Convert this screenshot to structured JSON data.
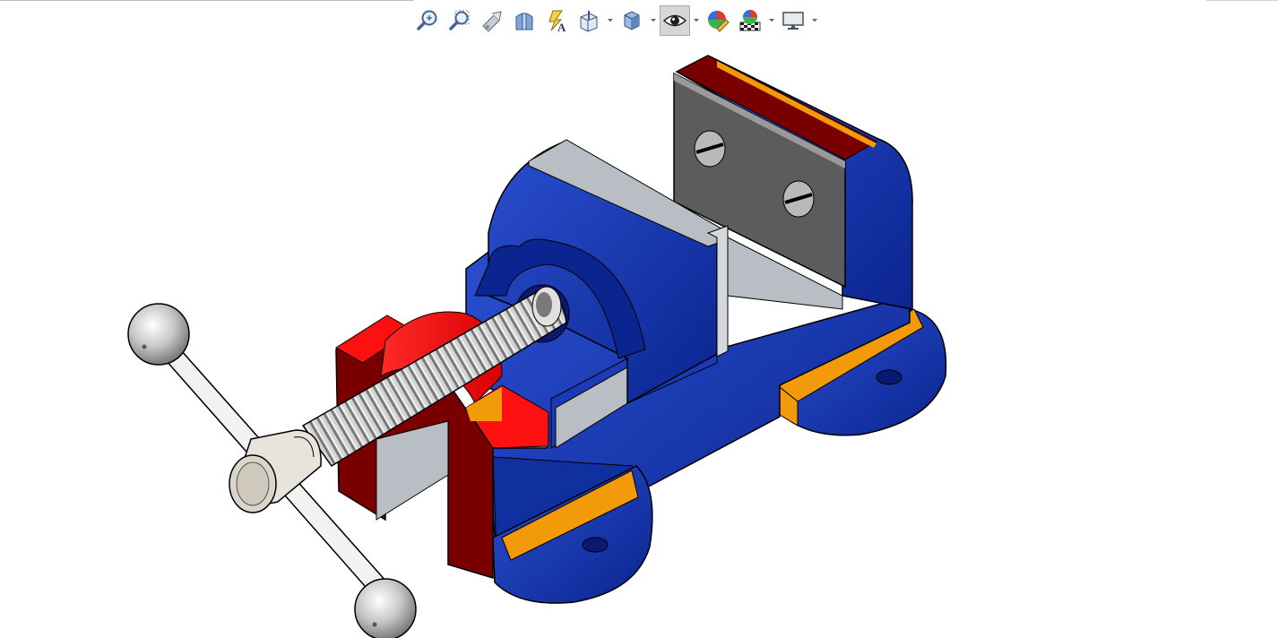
{
  "toolbar": {
    "tools": [
      {
        "name": "zoom-to-fit",
        "icon": "zoom-fit-icon"
      },
      {
        "name": "zoom-to-area",
        "icon": "zoom-area-icon"
      },
      {
        "name": "previous-view",
        "icon": "previous-view-icon"
      },
      {
        "name": "section-view",
        "icon": "section-view-icon"
      },
      {
        "name": "dynamic-annotation-views",
        "icon": "annotation-view-icon"
      },
      {
        "name": "view-orientation",
        "icon": "view-orientation-icon",
        "dropdown": true
      },
      {
        "name": "display-style",
        "icon": "display-style-icon",
        "dropdown": true
      },
      {
        "name": "hide-show-items",
        "icon": "eye-icon",
        "dropdown": true,
        "active": true
      },
      {
        "name": "edit-appearance",
        "icon": "appearance-icon"
      },
      {
        "name": "apply-scene",
        "icon": "scene-icon",
        "dropdown": true
      },
      {
        "name": "view-settings",
        "icon": "monitor-icon",
        "dropdown": true
      }
    ]
  },
  "colors": {
    "body_blue": "#0f2fa8",
    "section_red": "#7a0000",
    "section_orange": "#f39a0a",
    "jaw_red": "#ff1010",
    "jaw_gray": "#5a5a5a",
    "slide_light": "#b9bec4",
    "screw_gray": "#a8a8a8",
    "handle_white": "#efefef"
  }
}
